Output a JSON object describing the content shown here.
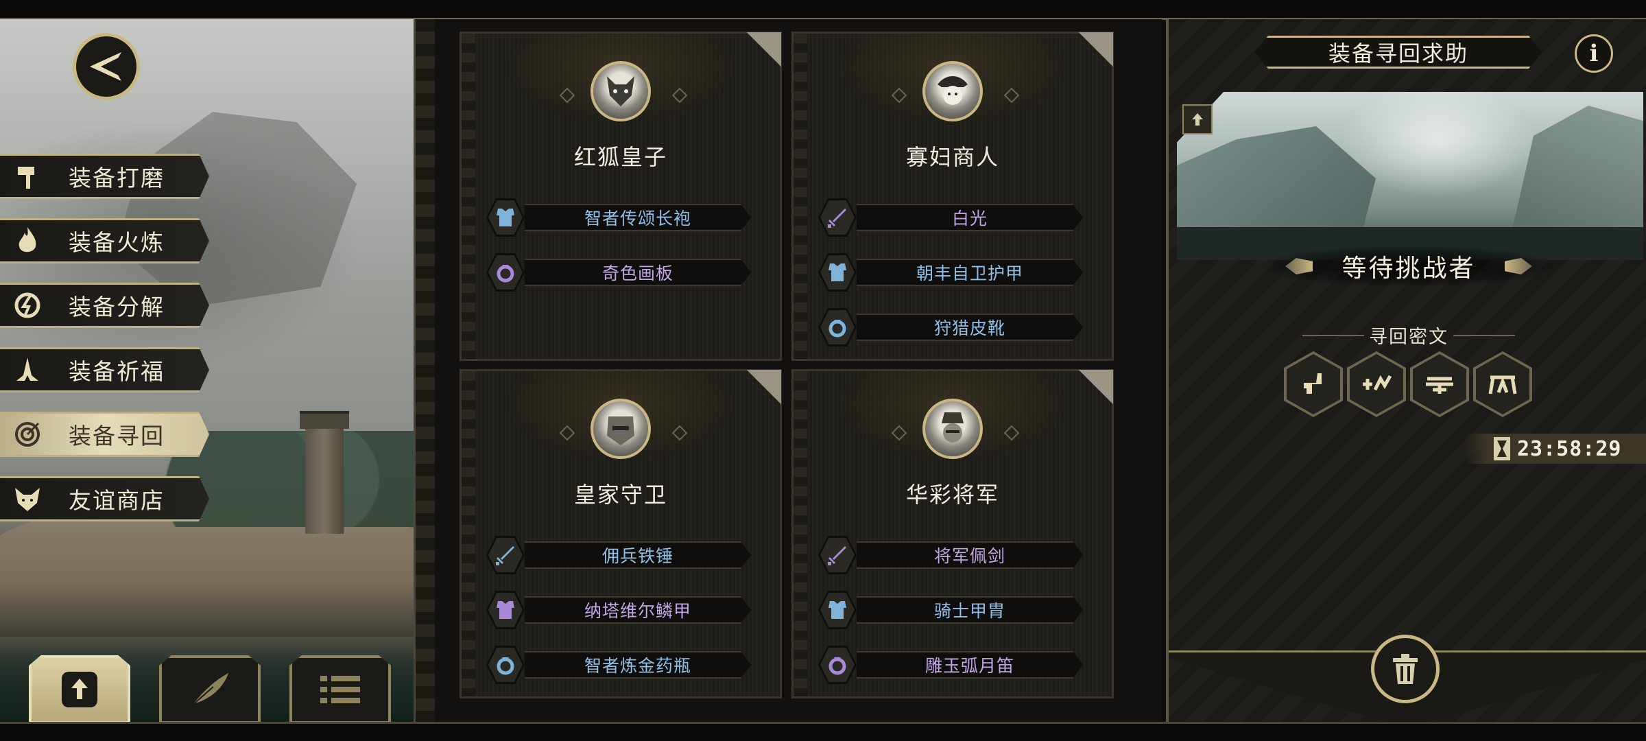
{
  "left_menu": {
    "items": [
      {
        "label": "装备打磨",
        "icon": "hammer-icon"
      },
      {
        "label": "装备火炼",
        "icon": "flame-icon"
      },
      {
        "label": "装备分解",
        "icon": "disassemble-icon"
      },
      {
        "label": "装备祈福",
        "icon": "prayer-hands-icon"
      },
      {
        "label": "装备寻回",
        "icon": "target-icon",
        "active": true
      },
      {
        "label": "友谊商店",
        "icon": "fox-icon"
      }
    ]
  },
  "bottom_tabs": [
    {
      "icon": "upload-icon",
      "active": true
    },
    {
      "icon": "feather-icon"
    },
    {
      "icon": "list-icon"
    }
  ],
  "cards": [
    {
      "name": "红狐皇子",
      "items": [
        {
          "label": "智者传颂长袍",
          "type": "armor",
          "color": "#8fc1e8"
        },
        {
          "label": "奇色画板",
          "type": "ring",
          "color": "#c2a6e6"
        }
      ]
    },
    {
      "name": "寡妇商人",
      "items": [
        {
          "label": "白光",
          "type": "sword",
          "color": "#c2a6e6"
        },
        {
          "label": "朝丰自卫护甲",
          "type": "armor",
          "color": "#8fc1e8"
        },
        {
          "label": "狩猎皮靴",
          "type": "ring",
          "color": "#8fc1e8"
        }
      ]
    },
    {
      "name": "皇家守卫",
      "items": [
        {
          "label": "佣兵铁锤",
          "type": "sword",
          "color": "#8fc1e8"
        },
        {
          "label": "纳塔维尔鳞甲",
          "type": "armor",
          "color": "#c2a6e6"
        },
        {
          "label": "智者炼金药瓶",
          "type": "ring",
          "color": "#8fc1e8"
        }
      ]
    },
    {
      "name": "华彩将军",
      "items": [
        {
          "label": "将军佩剑",
          "type": "sword",
          "color": "#c2a6e6"
        },
        {
          "label": "骑士甲胄",
          "type": "armor",
          "color": "#8fc1e8"
        },
        {
          "label": "雕玉弧月笛",
          "type": "ring",
          "color": "#c2a6e6"
        }
      ]
    }
  ],
  "right_panel": {
    "title": "装备寻回求助",
    "info_icon": "i",
    "status": "等待挑战者",
    "cipher_title": "寻回密文",
    "ciphers": [
      "cipher-glyph-1-icon",
      "cipher-glyph-2-icon",
      "cipher-glyph-3-icon",
      "cipher-glyph-4-icon"
    ],
    "timer": "23:58:29"
  },
  "colors": {
    "gold": "#c9b883",
    "blue_item": "#8fc1e8",
    "purple_item": "#c2a6e6"
  }
}
